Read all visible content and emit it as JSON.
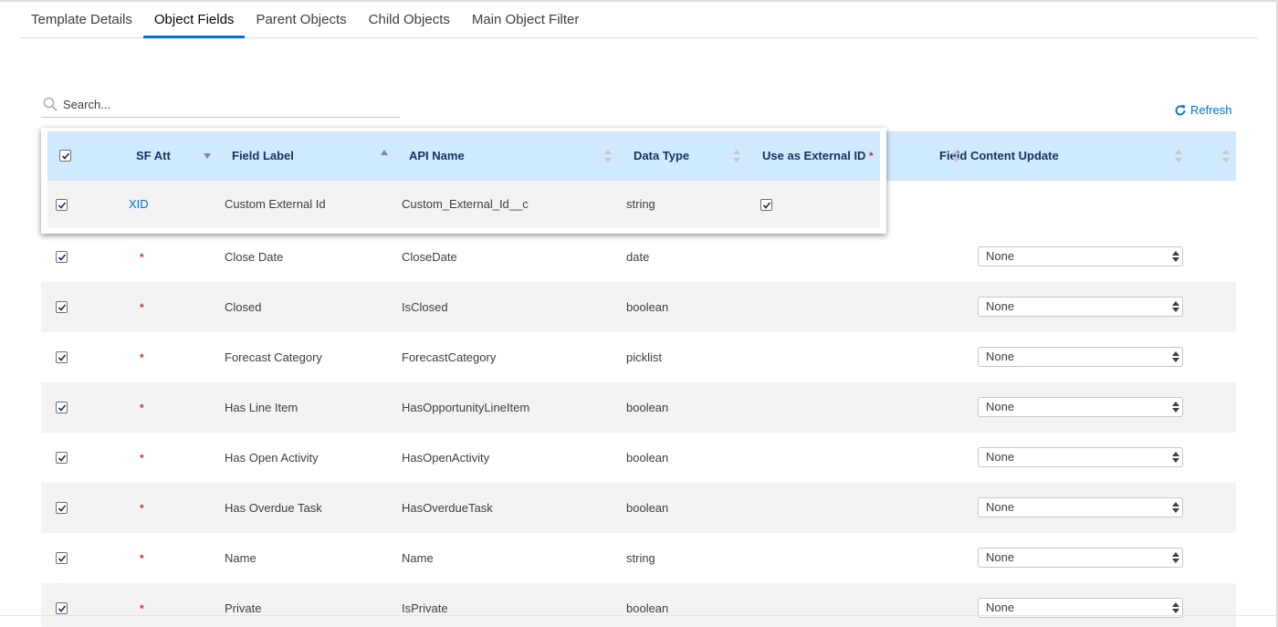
{
  "tabs": [
    {
      "label": "Template Details",
      "active": false
    },
    {
      "label": "Object Fields",
      "active": true
    },
    {
      "label": "Parent Objects",
      "active": false
    },
    {
      "label": "Child Objects",
      "active": false
    },
    {
      "label": "Main Object Filter",
      "active": false
    }
  ],
  "search": {
    "placeholder": "Search..."
  },
  "refresh_label": "Refresh",
  "columns": {
    "sf_att": "SF Att",
    "field_label": "Field Label",
    "api_name": "API Name",
    "data_type": "Data Type",
    "external_id": "Use as External ID",
    "field_content_update": "Field Content Update"
  },
  "popout_row": {
    "sf_att": "XID",
    "field_label": "Custom External Id",
    "api_name": "Custom_External_Id__c",
    "data_type": "string"
  },
  "rows": [
    {
      "field_label": "Close Date",
      "api_name": "CloseDate",
      "data_type": "date",
      "update": "None"
    },
    {
      "field_label": "Closed",
      "api_name": "IsClosed",
      "data_type": "boolean",
      "update": "None"
    },
    {
      "field_label": "Forecast Category",
      "api_name": "ForecastCategory",
      "data_type": "picklist",
      "update": "None"
    },
    {
      "field_label": "Has Line Item",
      "api_name": "HasOpportunityLineItem",
      "data_type": "boolean",
      "update": "None"
    },
    {
      "field_label": "Has Open Activity",
      "api_name": "HasOpenActivity",
      "data_type": "boolean",
      "update": "None"
    },
    {
      "field_label": "Has Overdue Task",
      "api_name": "HasOverdueTask",
      "data_type": "boolean",
      "update": "None"
    },
    {
      "field_label": "Name",
      "api_name": "Name",
      "data_type": "string",
      "update": "None"
    },
    {
      "field_label": "Private",
      "api_name": "IsPrivate",
      "data_type": "boolean",
      "update": "None"
    }
  ],
  "required_marker": "*",
  "colors": {
    "accent": "#0070d2",
    "header_bg": "#cfe9fe",
    "required": "#c23934"
  }
}
